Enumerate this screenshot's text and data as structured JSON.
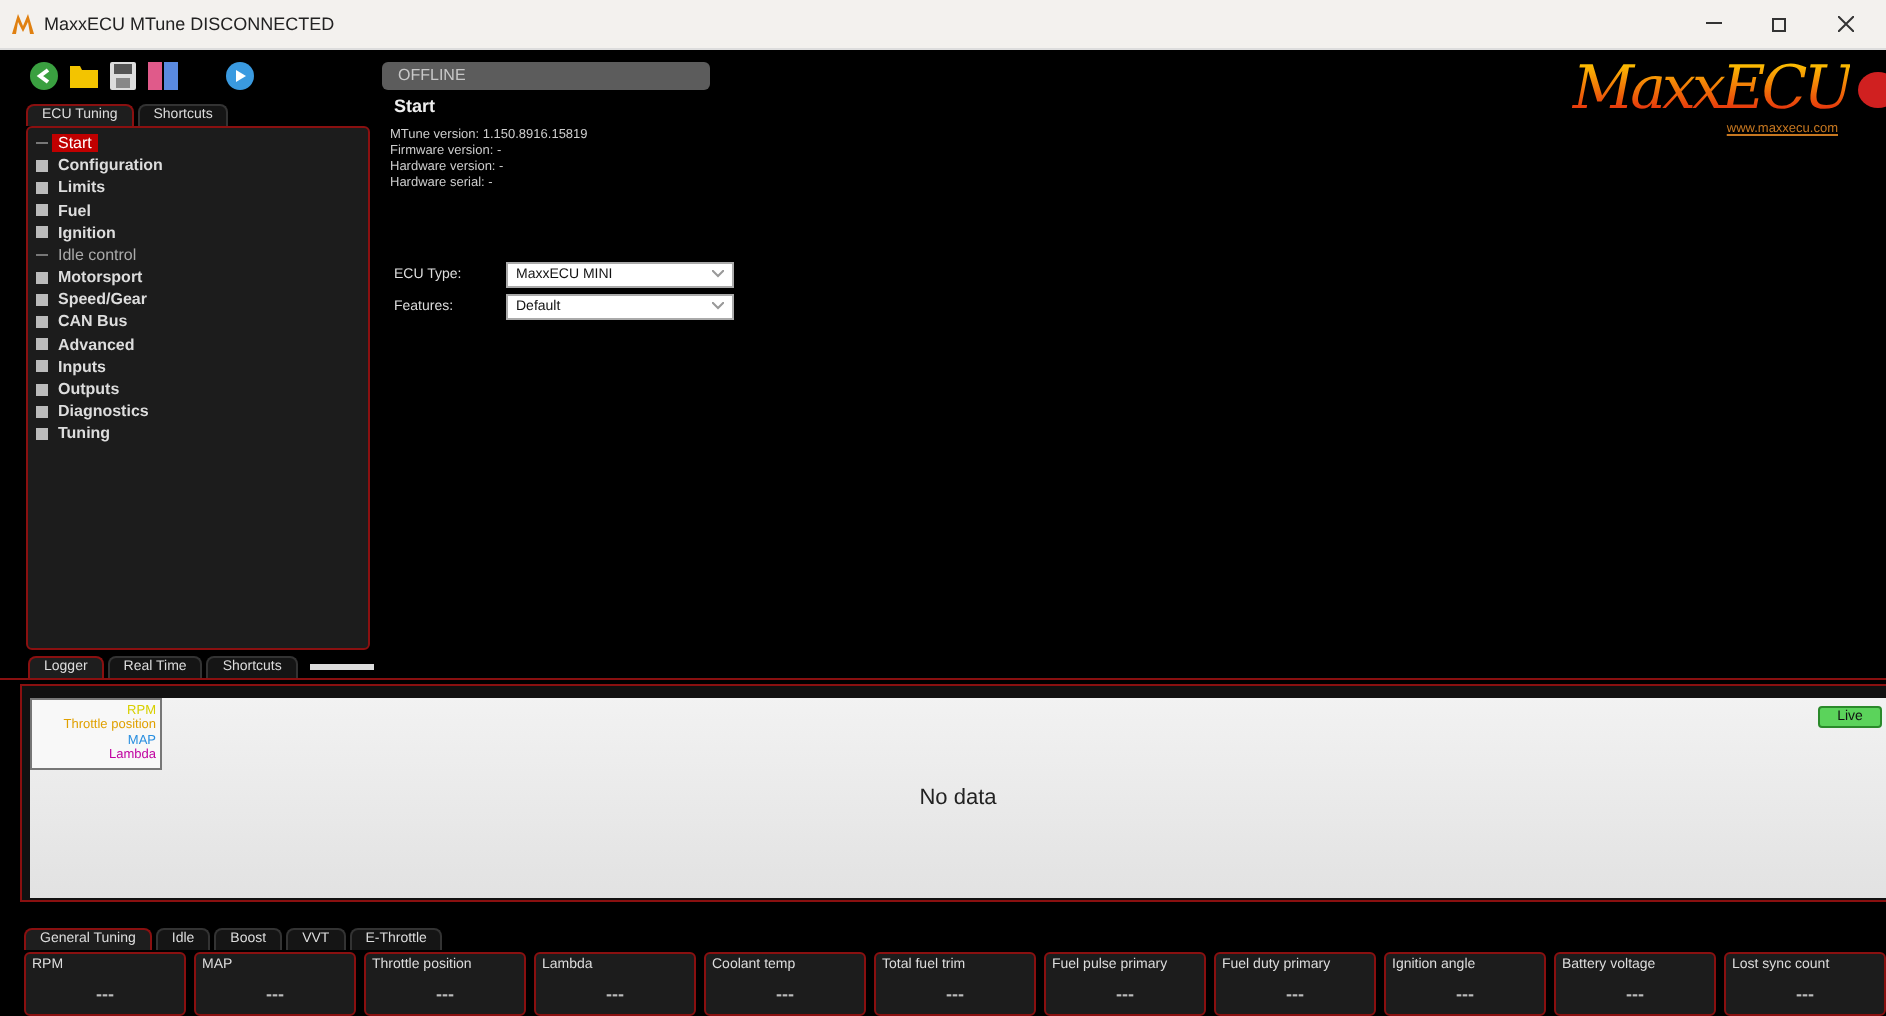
{
  "window": {
    "title": "MaxxECU MTune DISCONNECTED"
  },
  "status": "OFFLINE",
  "left_tabs": [
    {
      "label": "ECU Tuning",
      "selected": true
    },
    {
      "label": "Shortcuts",
      "selected": false
    }
  ],
  "tree": [
    {
      "label": "Start",
      "expandable": false,
      "selected": true
    },
    {
      "label": "Configuration",
      "expandable": true,
      "selected": false
    },
    {
      "label": "Limits",
      "expandable": true,
      "selected": false
    },
    {
      "label": "Fuel",
      "expandable": true,
      "selected": false
    },
    {
      "label": "Ignition",
      "expandable": true,
      "selected": false
    },
    {
      "label": "Idle control",
      "expandable": false,
      "selected": false
    },
    {
      "label": "Motorsport",
      "expandable": true,
      "selected": false
    },
    {
      "label": "Speed/Gear",
      "expandable": true,
      "selected": false
    },
    {
      "label": "CAN Bus",
      "expandable": true,
      "selected": false
    },
    {
      "label": "Advanced",
      "expandable": true,
      "selected": false
    },
    {
      "label": "Inputs",
      "expandable": true,
      "selected": false
    },
    {
      "label": "Outputs",
      "expandable": true,
      "selected": false
    },
    {
      "label": "Diagnostics",
      "expandable": true,
      "selected": false
    },
    {
      "label": "Tuning",
      "expandable": true,
      "selected": false
    }
  ],
  "page": {
    "title": "Start",
    "info": [
      "MTune version: 1.150.8916.15819",
      "Firmware version: -",
      "Hardware version: -",
      "Hardware serial: -"
    ],
    "fields": [
      {
        "label": "ECU Type:",
        "value": "MaxxECU MINI"
      },
      {
        "label": "Features:",
        "value": "Default"
      }
    ]
  },
  "logo": {
    "text": "MaxxECU",
    "link": "www.maxxecu.com"
  },
  "logger_tabs": [
    {
      "label": "Logger",
      "selected": true
    },
    {
      "label": "Real Time",
      "selected": false
    },
    {
      "label": "Shortcuts",
      "selected": false
    }
  ],
  "legend": [
    {
      "label": "RPM",
      "color": "#d8d000"
    },
    {
      "label": "Throttle position",
      "color": "#e0a000"
    },
    {
      "label": "MAP",
      "color": "#2a8fe0"
    },
    {
      "label": "Lambda",
      "color": "#c000a0"
    }
  ],
  "live_button": "Live",
  "no_data": "No data",
  "gauge_tabs": [
    {
      "label": "General Tuning",
      "selected": true
    },
    {
      "label": "Idle",
      "selected": false
    },
    {
      "label": "Boost",
      "selected": false
    },
    {
      "label": "VVT",
      "selected": false
    },
    {
      "label": "E-Throttle",
      "selected": false
    }
  ],
  "gauges": [
    {
      "label": "RPM",
      "value": "---"
    },
    {
      "label": "MAP",
      "value": "---"
    },
    {
      "label": "Throttle position",
      "value": "---"
    },
    {
      "label": "Lambda",
      "value": "---"
    },
    {
      "label": "Coolant temp",
      "value": "---"
    },
    {
      "label": "Total fuel trim",
      "value": "---"
    },
    {
      "label": "Fuel pulse primary",
      "value": "---"
    },
    {
      "label": "Fuel duty primary",
      "value": "---"
    },
    {
      "label": "Ignition angle",
      "value": "---"
    },
    {
      "label": "Battery voltage",
      "value": "---"
    },
    {
      "label": "Lost sync count",
      "value": "---"
    }
  ]
}
